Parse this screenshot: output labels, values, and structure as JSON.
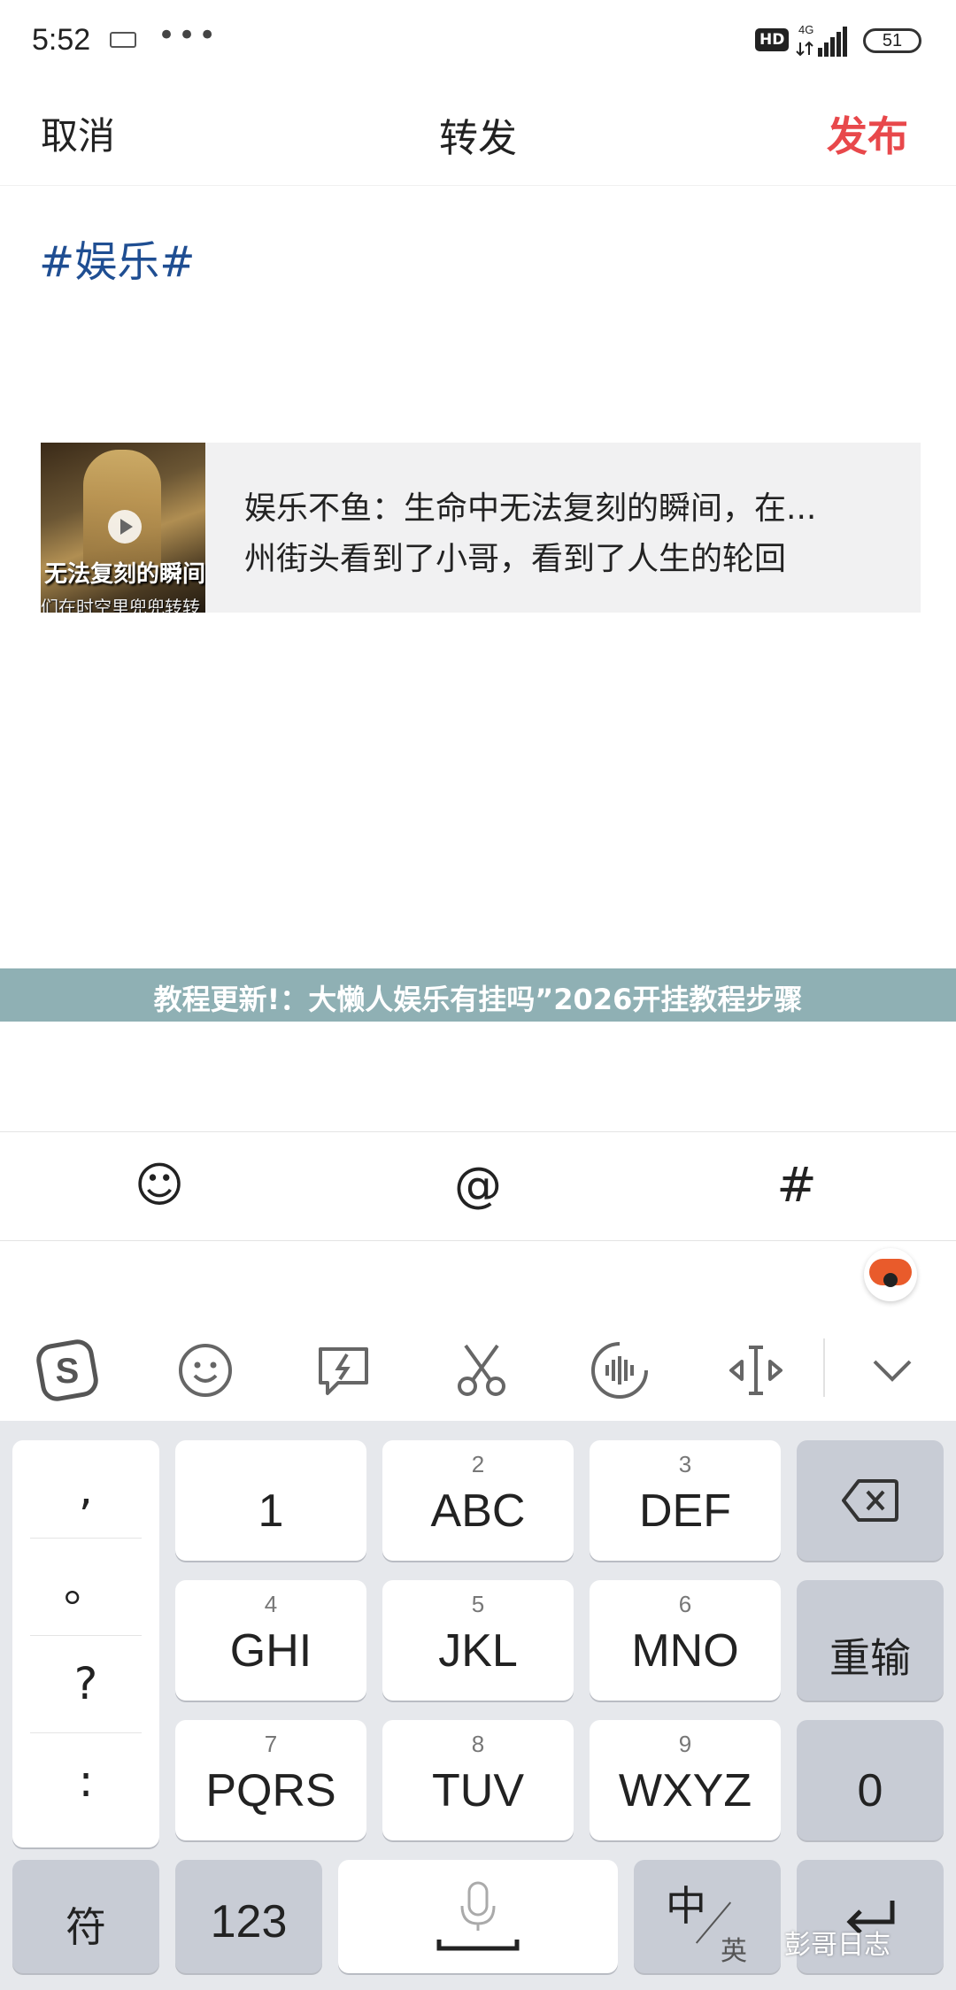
{
  "status_bar": {
    "time": "5:52",
    "dots": "•••",
    "network_badge": "HD",
    "network_type": "4G",
    "battery": "51"
  },
  "header": {
    "cancel": "取消",
    "title": "转发",
    "publish": "发布"
  },
  "compose": {
    "topic": "#娱乐#"
  },
  "card": {
    "line1": "娱乐不鱼：生命中无法复刻的瞬间，在...",
    "line2": "州街头看到了小哥，看到了人生的轮回",
    "thumb_caption": "无法复刻的瞬间",
    "thumb_caption2": "们在时空里兜兜转转"
  },
  "banner": {
    "text": "教程更新!：大懒人娱乐有挂吗”2026开挂教程步骤"
  },
  "compose_toolbar": {
    "emoji": "☺",
    "mention": "@",
    "topic": "#"
  },
  "keyboard": {
    "punct": [
      ",",
      "。",
      "?",
      ":"
    ],
    "keys": [
      {
        "num": "",
        "label": "1"
      },
      {
        "num": "2",
        "label": "ABC"
      },
      {
        "num": "3",
        "label": "DEF"
      },
      {
        "num": "4",
        "label": "GHI"
      },
      {
        "num": "5",
        "label": "JKL"
      },
      {
        "num": "6",
        "label": "MNO"
      },
      {
        "num": "7",
        "label": "PQRS"
      },
      {
        "num": "8",
        "label": "TUV"
      },
      {
        "num": "9",
        "label": "WXYZ"
      }
    ],
    "delete_icon": "⌫",
    "retype": "重输",
    "zero": "0",
    "symbol": "符",
    "numbers": "123",
    "lang_main": "中",
    "lang_sub": "英"
  },
  "watermark": "彭哥日志"
}
